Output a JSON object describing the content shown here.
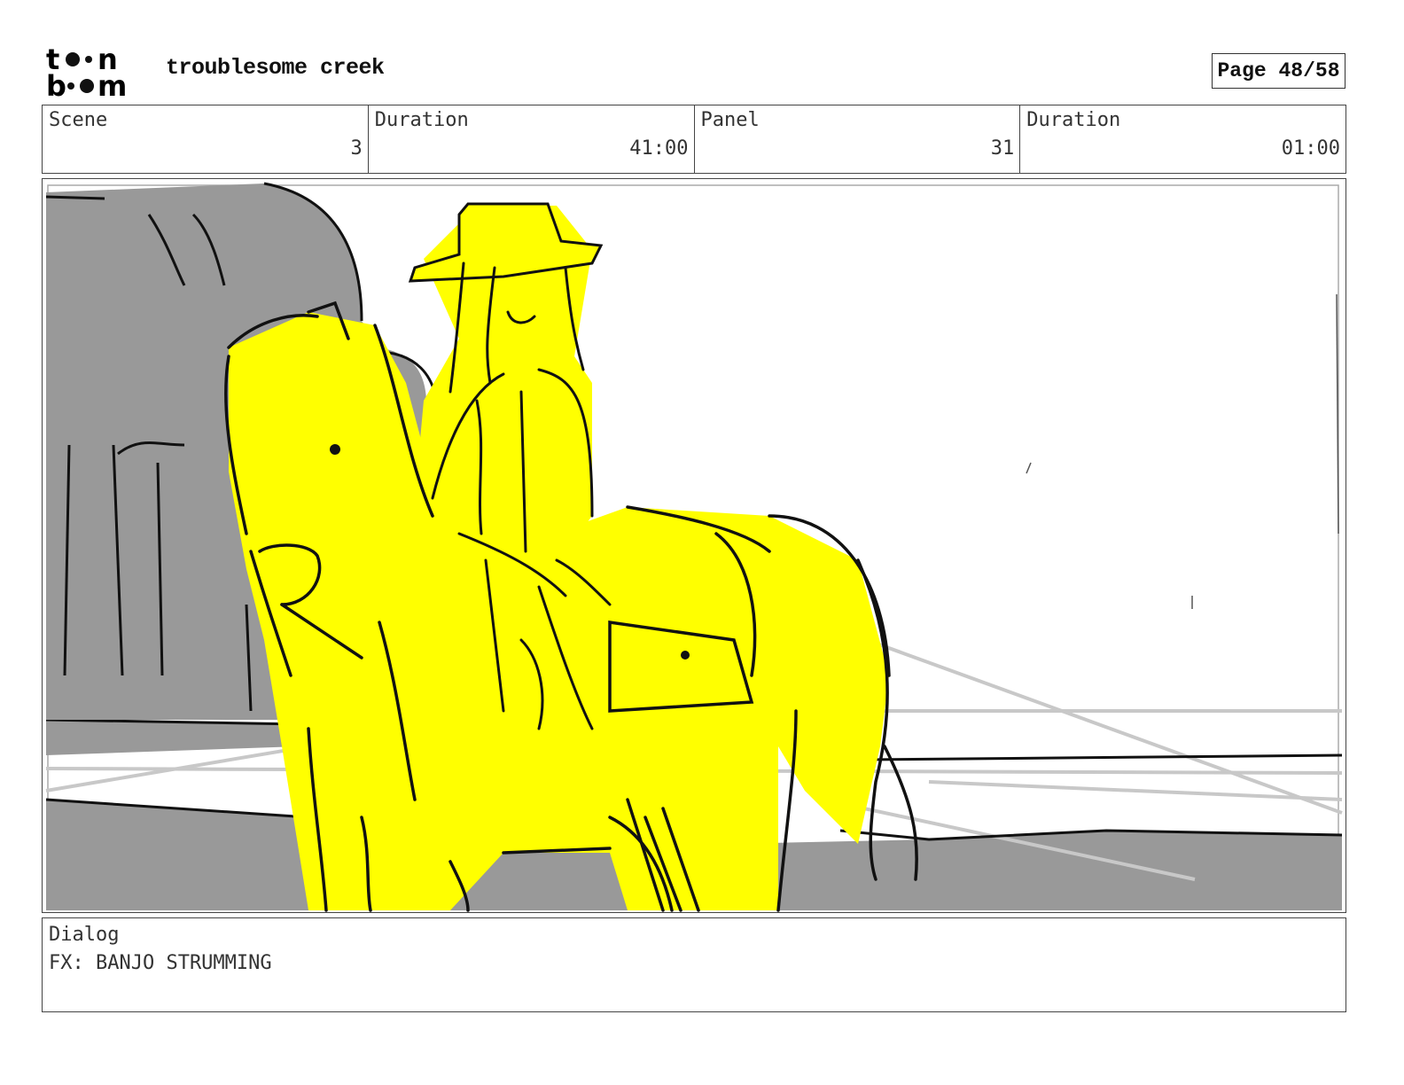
{
  "header": {
    "logo_text_top": "toon",
    "logo_text_bottom": "boom",
    "project_title": "troublesome creek",
    "page_label": "Page 48/58"
  },
  "info": {
    "scene_label": "Scene",
    "scene_value": "3",
    "scene_duration_label": "Duration",
    "scene_duration_value": "41:00",
    "panel_label": "Panel",
    "panel_value": "31",
    "panel_duration_label": "Duration",
    "panel_duration_value": "01:00"
  },
  "panel_image": {
    "colors": {
      "fill": "#ffff00",
      "shadow": "#999999",
      "line": "#111111",
      "guide": "#c8c8c8"
    }
  },
  "dialog": {
    "label": "Dialog",
    "text": "FX: BANJO STRUMMING"
  }
}
